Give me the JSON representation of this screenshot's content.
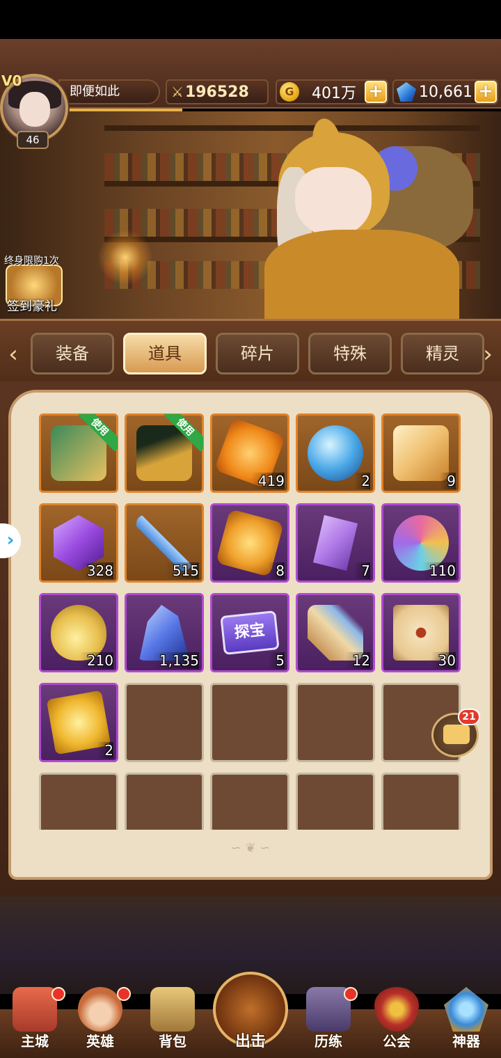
{
  "player": {
    "vip": "V0",
    "level": "46",
    "name": "即便如此"
  },
  "resources": {
    "power": "196528",
    "gold": "401万",
    "gems": "10,661"
  },
  "banner": {
    "gift_top": "终身限购1次",
    "gift_bottom": "签到豪礼"
  },
  "tabs": [
    {
      "label": "装备",
      "active": false
    },
    {
      "label": "道具",
      "active": true
    },
    {
      "label": "碎片",
      "active": false
    },
    {
      "label": "特殊",
      "active": false
    },
    {
      "label": "精灵",
      "active": false
    }
  ],
  "items": [
    {
      "name": "spellbook",
      "rarity": "orange",
      "count": "",
      "use_label": "使用",
      "color": "#3a8a5a"
    },
    {
      "name": "treasure-chest",
      "rarity": "orange",
      "count": "",
      "use_label": "使用",
      "color": "#d8a43a"
    },
    {
      "name": "amber-crystal",
      "rarity": "orange",
      "count": "419",
      "use_label": "",
      "color": "#f08a1a"
    },
    {
      "name": "crystal-orb",
      "rarity": "orange",
      "count": "2",
      "use_label": "",
      "color": "#4aa8e8"
    },
    {
      "name": "golden-scroll",
      "rarity": "orange",
      "count": "9",
      "use_label": "",
      "color": "#f0c070"
    },
    {
      "name": "purple-gem",
      "rarity": "orange",
      "count": "328",
      "use_label": "",
      "color": "#9a4ae0"
    },
    {
      "name": "blue-sword",
      "rarity": "orange",
      "count": "515",
      "use_label": "",
      "color": "#4a8ad8"
    },
    {
      "name": "sun-rune",
      "rarity": "purple",
      "count": "8",
      "use_label": "",
      "color": "#f0a02a"
    },
    {
      "name": "purple-shard",
      "rarity": "purple",
      "count": "7",
      "use_label": "",
      "color": "#b07ae8"
    },
    {
      "name": "rainbow-orb",
      "rarity": "purple",
      "count": "110",
      "use_label": "",
      "color": "#e86aa0"
    },
    {
      "name": "potion-flask",
      "rarity": "purple",
      "count": "210",
      "use_label": "",
      "color": "#e8c050"
    },
    {
      "name": "blue-crystal",
      "rarity": "purple",
      "count": "1,135",
      "use_label": "",
      "color": "#5a7ae8"
    },
    {
      "name": "treasure-ticket",
      "rarity": "purple",
      "count": "5",
      "use_label": "",
      "color": "#7a5ae0",
      "ticket_label": "探宝"
    },
    {
      "name": "rolled-scroll",
      "rarity": "purple",
      "count": "12",
      "use_label": "",
      "color": "#c8965a"
    },
    {
      "name": "beast-map",
      "rarity": "purple",
      "count": "30",
      "use_label": "",
      "color": "#e8c890"
    },
    {
      "name": "golden-card",
      "rarity": "purple",
      "count": "2",
      "use_label": "",
      "color": "#f0b830"
    }
  ],
  "chat": {
    "badge": "21"
  },
  "nav": [
    {
      "label": "主城",
      "dot": true,
      "icon": "castle-icon",
      "color": "#c84a3a"
    },
    {
      "label": "英雄",
      "dot": true,
      "icon": "hero-icon",
      "color": "#c86a3a"
    },
    {
      "label": "背包",
      "dot": false,
      "icon": "backpack-icon",
      "color": "#c8a05a"
    },
    {
      "label": "出击",
      "dot": false,
      "icon": "crossed-swords-icon",
      "color": "#c0702a"
    },
    {
      "label": "历练",
      "dot": true,
      "icon": "tower-icon",
      "color": "#6a5a8a"
    },
    {
      "label": "公会",
      "dot": false,
      "icon": "guild-shield-icon",
      "color": "#b8302a"
    },
    {
      "label": "神器",
      "dot": false,
      "icon": "artifact-icon",
      "color": "#3a8ad8"
    }
  ]
}
